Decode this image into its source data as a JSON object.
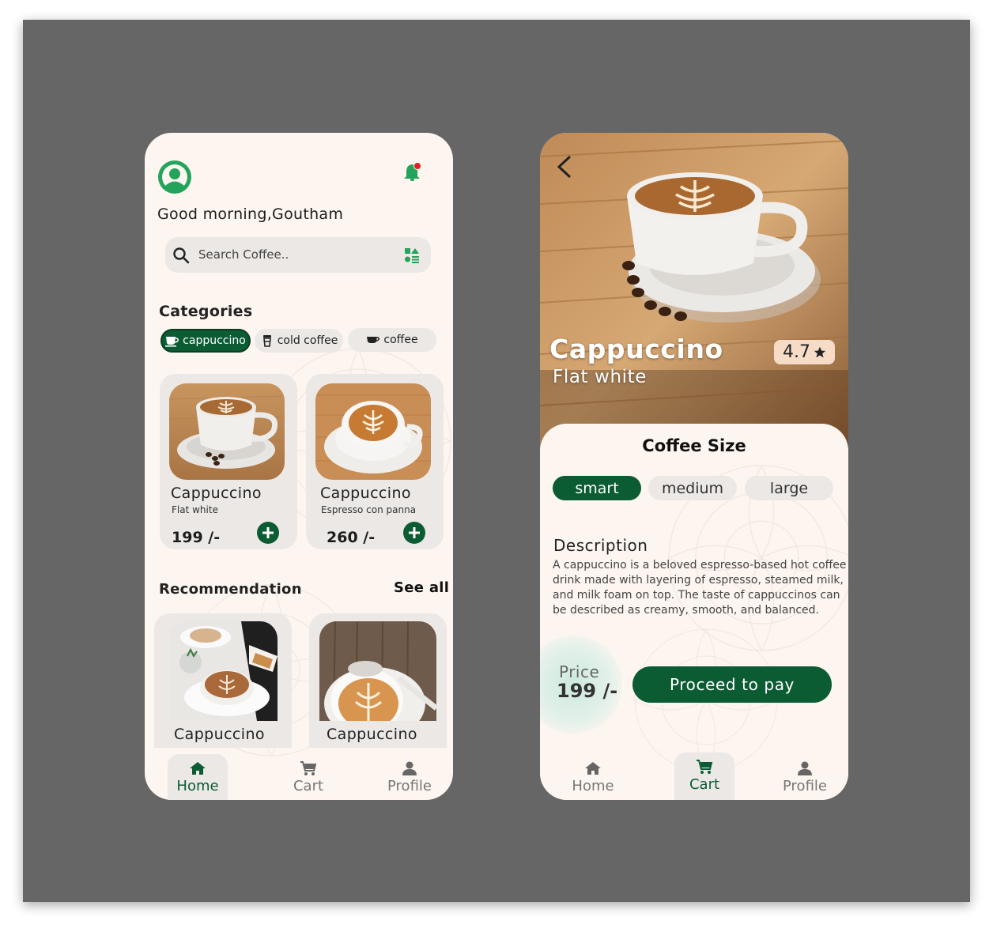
{
  "home": {
    "greeting": "Good morning,Goutham",
    "search_placeholder": "Search Coffee..",
    "categories_title": "Categories",
    "categories": [
      {
        "label": "cappuccino",
        "active": true
      },
      {
        "label": "cold coffee",
        "active": false
      },
      {
        "label": "coffee",
        "active": false
      }
    ],
    "products": [
      {
        "name": "Cappuccino",
        "subtitle": "Flat white",
        "price": "199 /-"
      },
      {
        "name": "Cappuccino",
        "subtitle": "Espresso con panna",
        "price": "260 /-"
      }
    ],
    "recommendation_title": "Recommendation",
    "see_all": "See all",
    "recommendations": [
      {
        "name": "Cappuccino"
      },
      {
        "name": "Cappuccino"
      }
    ],
    "nav": [
      {
        "label": "Home",
        "icon": "home-icon",
        "active": true
      },
      {
        "label": "Cart",
        "icon": "cart-icon",
        "active": false
      },
      {
        "label": "Profile",
        "icon": "profile-icon",
        "active": false
      }
    ]
  },
  "detail": {
    "title": "Cappuccino",
    "subtitle": "Flat white",
    "rating": "4.7",
    "size_title": "Coffee Size",
    "sizes": [
      {
        "label": "smart",
        "active": true
      },
      {
        "label": "medium",
        "active": false
      },
      {
        "label": "large",
        "active": false
      }
    ],
    "description_title": "Description",
    "description": "A cappuccino is a beloved espresso-based hot coffee drink made with layering of espresso, steamed milk, and milk foam on top. The taste of cappuccinos can be described as creamy, smooth, and balanced.",
    "price_label": "Price",
    "price": "199 /-",
    "pay_button": "Proceed to pay",
    "nav": [
      {
        "label": "Home",
        "icon": "home-icon",
        "active": false
      },
      {
        "label": "Cart",
        "icon": "cart-icon",
        "active": true
      },
      {
        "label": "Profile",
        "icon": "profile-icon",
        "active": false
      }
    ]
  },
  "colors": {
    "primary_green": "#0b5c33",
    "background": "#fdf5f0",
    "chip_grey": "#ebe8e6",
    "canvas_grey": "#666666"
  }
}
